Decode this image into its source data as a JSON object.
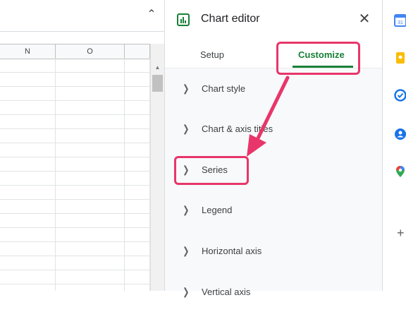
{
  "sheet": {
    "collapse_icon": "chevron-up-icon",
    "columns": [
      "N",
      "O"
    ]
  },
  "editor": {
    "title": "Chart editor",
    "close_icon": "close-icon",
    "tabs": [
      {
        "label": "Setup",
        "active": false
      },
      {
        "label": "Customize",
        "active": true
      }
    ],
    "sections": [
      {
        "label": "Chart style"
      },
      {
        "label": "Chart & axis titles"
      },
      {
        "label": "Series"
      },
      {
        "label": "Legend"
      },
      {
        "label": "Horizontal axis"
      },
      {
        "label": "Vertical axis"
      }
    ]
  },
  "rail": {
    "icons": [
      "calendar-icon",
      "keep-icon",
      "tasks-icon",
      "contacts-icon",
      "maps-icon"
    ],
    "add_icon": "plus-icon"
  },
  "colors": {
    "accent": "#188038",
    "highlight": "#e8366a"
  }
}
